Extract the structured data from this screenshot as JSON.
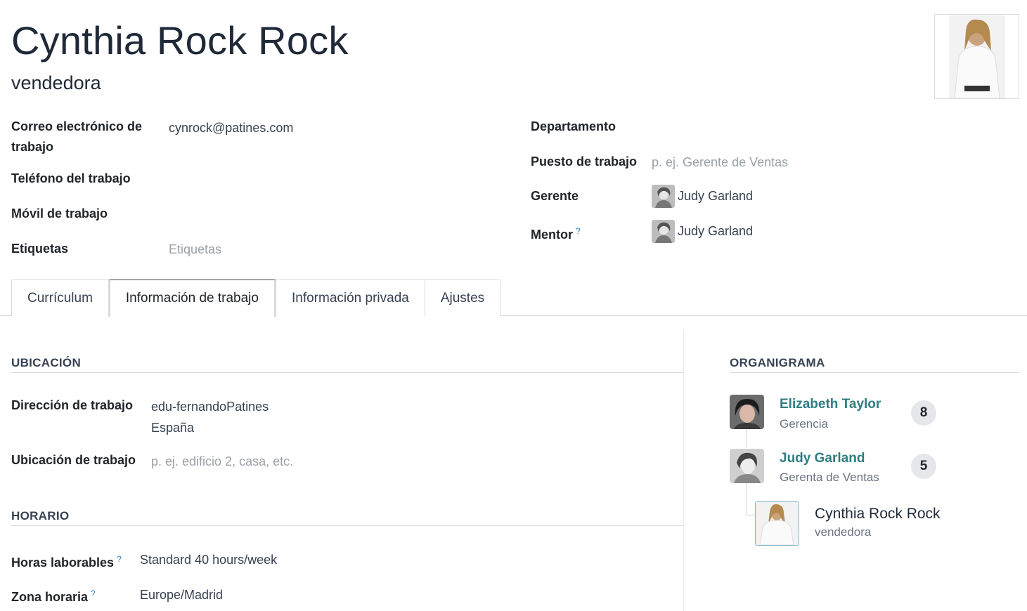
{
  "header": {
    "name": "Cynthia Rock Rock",
    "job_title": "vendedora",
    "photo_icon": "employee-photo"
  },
  "left_fields": {
    "email_label_line1": "Correo electrónico de",
    "email_label_line2": "trabajo",
    "email_value": "cynrock@patines.com",
    "work_phone_label": "Teléfono del trabajo",
    "work_mobile_label": "Móvil de trabajo",
    "tags_label": "Etiquetas",
    "tags_placeholder": "Etiquetas"
  },
  "right_fields": {
    "department_label": "Departamento",
    "job_position_label": "Puesto de trabajo",
    "job_position_placeholder": "p. ej. Gerente de Ventas",
    "manager_label": "Gerente",
    "manager_value": "Judy Garland",
    "mentor_label": "Mentor",
    "mentor_help": "?",
    "mentor_value": "Judy Garland"
  },
  "tabs": [
    {
      "label": "Currículum"
    },
    {
      "label": "Información de trabajo"
    },
    {
      "label": "Información privada"
    },
    {
      "label": "Ajustes"
    }
  ],
  "location_section": {
    "title": "UBICACIÓN",
    "work_address_label": "Dirección de trabajo",
    "work_address_line1": "edu-fernandoPatines",
    "work_address_line2": "España",
    "work_location_label": "Ubicación de trabajo",
    "work_location_placeholder": "p. ej. edificio 2, casa, etc."
  },
  "schedule_section": {
    "title": "HORARIO",
    "working_hours_label": "Horas laborables",
    "working_hours_help": "?",
    "working_hours_value": "Standard 40 hours/week",
    "timezone_label": "Zona horaria",
    "timezone_help": "?",
    "timezone_value": "Europe/Madrid"
  },
  "org_chart": {
    "title": "ORGANIGRAMA",
    "people": [
      {
        "name": "Elizabeth Taylor",
        "role": "Gerencia",
        "count": "8"
      },
      {
        "name": "Judy Garland",
        "role": "Gerenta de Ventas",
        "count": "5"
      }
    ],
    "current": {
      "name": "Cynthia Rock Rock",
      "role": "vendedora"
    }
  },
  "colors": {
    "accent_link": "#2e7d82",
    "help_blue": "#3b82c4",
    "border": "#d8dadd"
  }
}
